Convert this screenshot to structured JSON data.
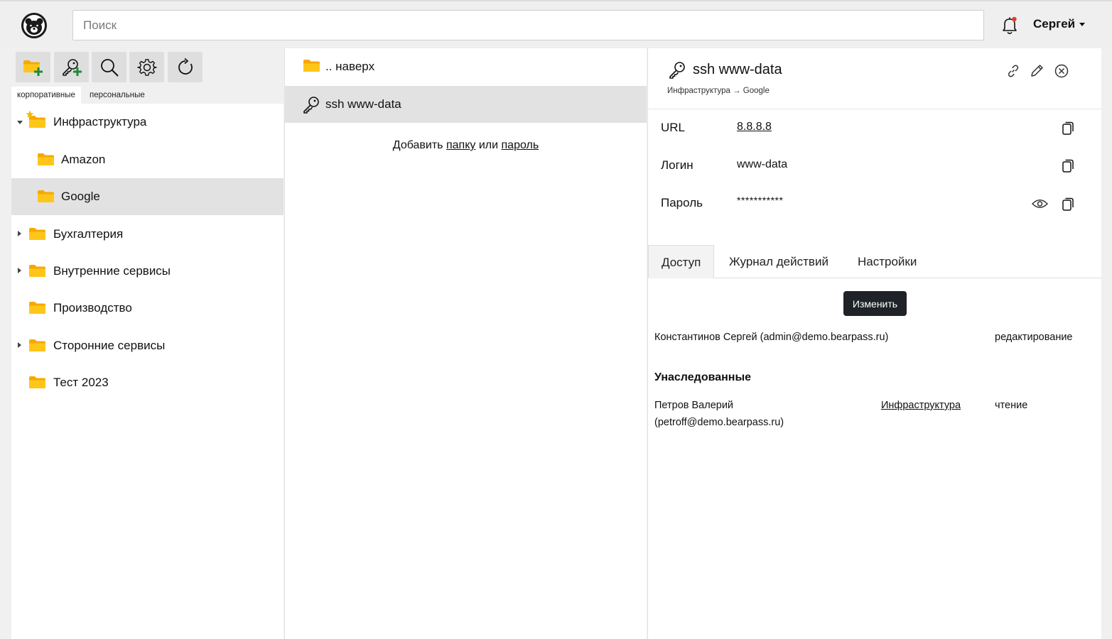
{
  "header": {
    "search_placeholder": "Поиск",
    "user_name": "Сергей",
    "notification_dot_color": "#e53935"
  },
  "sidebar": {
    "scope_tabs": [
      {
        "label": "корпоративные",
        "active": true
      },
      {
        "label": "персональные",
        "active": false
      }
    ],
    "tree": [
      {
        "label": "Инфраструктура",
        "expanded": true,
        "favorite": true
      },
      {
        "label": "Amazon",
        "child": true
      },
      {
        "label": "Google",
        "child": true,
        "selected": true
      },
      {
        "label": "Бухгалтерия",
        "expandable": true
      },
      {
        "label": "Внутренние сервисы",
        "expandable": true
      },
      {
        "label": "Производство"
      },
      {
        "label": "Сторонние сервисы",
        "expandable": true
      },
      {
        "label": "Тест 2023"
      }
    ]
  },
  "list": {
    "up_label": ".. наверх",
    "items": [
      {
        "label": "ssh www-data",
        "selected": true
      }
    ],
    "add_prefix": "Добавить",
    "add_folder_link": "папку",
    "add_or": "или",
    "add_password_link": "пароль"
  },
  "detail": {
    "title": "ssh www-data",
    "breadcrumb": "Инфраструктура → Google",
    "fields": {
      "url_label": "URL",
      "url_value": "8.8.8.8",
      "login_label": "Логин",
      "login_value": "www-data",
      "password_label": "Пароль",
      "password_value": "***********"
    },
    "tabs": [
      {
        "label": "Доступ",
        "active": true
      },
      {
        "label": "Журнал действий",
        "active": false
      },
      {
        "label": "Настройки",
        "active": false
      }
    ],
    "edit_button": "Изменить",
    "access": [
      {
        "user": "Константинов Сергей (admin@demo.bearpass.ru)",
        "role": "редактирование"
      }
    ],
    "inherited_title": "Унаследованные",
    "inherited": [
      {
        "user_line1": "Петров Валерий",
        "user_line2": "(petroff@demo.bearpass.ru)",
        "source": "Инфраструктура",
        "role": "чтение"
      }
    ]
  },
  "colors": {
    "folder": "#f5b800",
    "plus": "#1e8a3a",
    "selected_row": "#e2e2e2",
    "dark_button": "#1f2328"
  },
  "icons": {
    "logo": "bear-logo-icon",
    "bell": "bell-icon",
    "folder": "folder-icon",
    "key": "key-icon",
    "copy": "copy-icon",
    "eye": "eye-icon",
    "link": "link-icon",
    "edit": "pencil-icon",
    "close": "close-circle-icon"
  }
}
